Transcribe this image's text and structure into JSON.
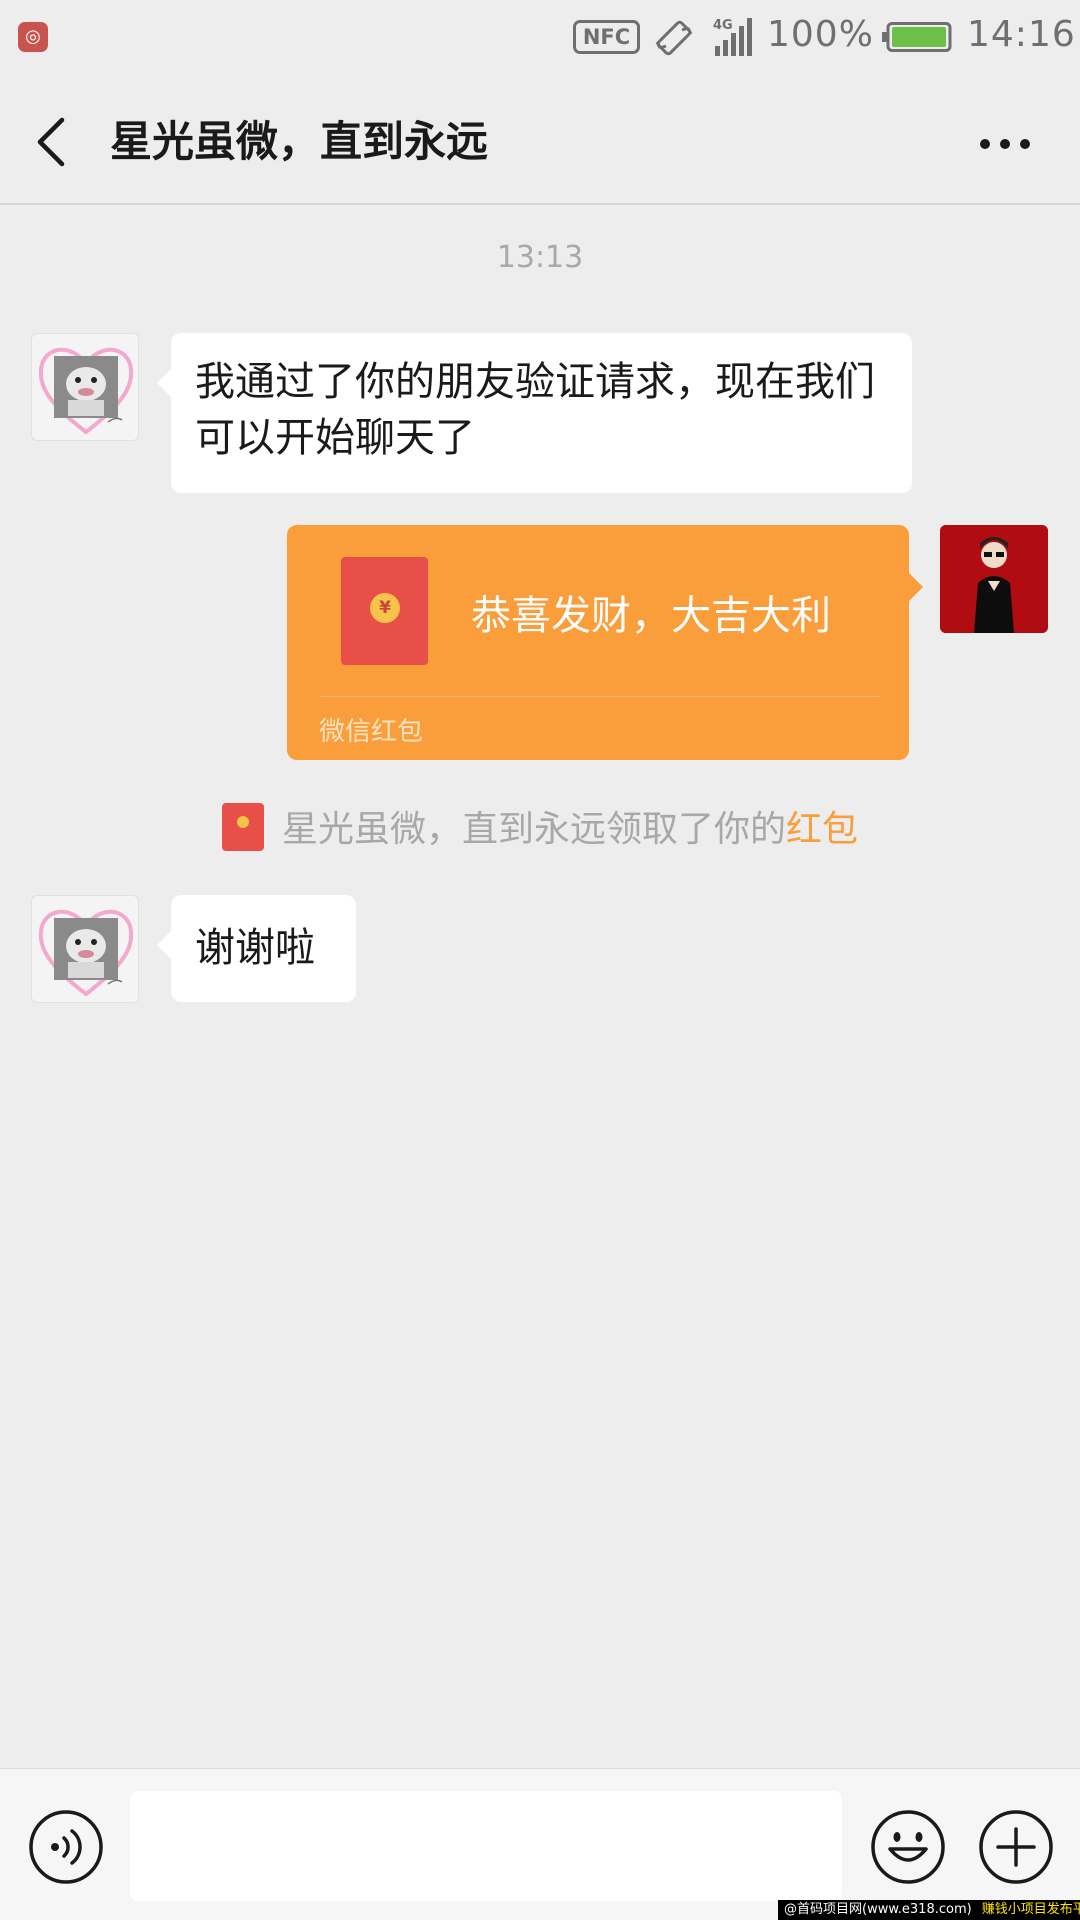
{
  "status_bar": {
    "notification_app_icon": "app-notification-icon",
    "nfc_label": "NFC",
    "network_label": "4G",
    "battery_percent": "100%",
    "battery_level": 1.0,
    "time": "14:16"
  },
  "header": {
    "title": "星光虽微，直到永远",
    "back_icon": "chevron-left-icon",
    "more_icon": "more-dots-icon"
  },
  "chat": {
    "timestamp": "13:13",
    "messages": [
      {
        "side": "left",
        "text": "我通过了你的朋友验证请求，现在我们可以开始聊天了"
      },
      {
        "side": "right",
        "type": "red_packet",
        "title": "恭喜发财，大吉大利",
        "footer": "微信红包",
        "coin_symbol": "¥"
      },
      {
        "side": "left",
        "text": "谢谢啦"
      }
    ],
    "system_notice": {
      "prefix": "星光虽微，直到永远领取了你的",
      "link": "红包"
    }
  },
  "input_bar": {
    "voice_icon": "voice-icon",
    "emoji_icon": "emoji-icon",
    "plus_icon": "plus-icon",
    "placeholder": ""
  },
  "watermark": {
    "left_text": "@首码项目网(www.e318.com)",
    "right_text": "赚钱小项目发布平台"
  },
  "colors": {
    "background": "#ededed",
    "red_packet": "#fa9d3b",
    "red_envelope": "#e94f49",
    "link": "#fa9d3b",
    "battery_fill": "#6cc04a"
  }
}
